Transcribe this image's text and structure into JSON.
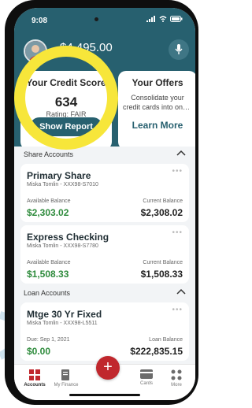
{
  "status": {
    "time": "9:08"
  },
  "header": {
    "total_balance": "$4,495.00"
  },
  "credit_card": {
    "title": "Your Credit Score",
    "score": "634",
    "rating": "Rating: FAIR",
    "button": "Show Report"
  },
  "offers_card": {
    "title": "Your Offers",
    "desc_line1": "Consolidate your",
    "desc_line2": "credit cards into one...",
    "link": "Learn More"
  },
  "sections": {
    "share_accounts": "Share Accounts",
    "loan_accounts": "Loan Accounts"
  },
  "accounts": [
    {
      "name": "Primary Share",
      "sub": "Miska Tomlin - XXX98-S7010",
      "left_label": "Available Balance",
      "left_value": "$2,303.02",
      "right_label": "Current Balance",
      "right_value": "$2,308.02"
    },
    {
      "name": "Express Checking",
      "sub": "Miska Tomlin - XXX98-S7780",
      "left_label": "Available Balance",
      "left_value": "$1,508.33",
      "right_label": "Current Balance",
      "right_value": "$1,508.33"
    }
  ],
  "loans": [
    {
      "name": "Mtge 30 Yr Fixed",
      "sub": "Miska Tomlin - XXX98-L5511",
      "left_label": "Due: Sep 1, 2021",
      "left_value": "$0.00",
      "right_label": "Loan Balance",
      "right_value": "$222,835.15"
    }
  ],
  "tabbar": {
    "accounts": "Accounts",
    "my_finance": "My Finance",
    "cards": "Cards",
    "more": "More"
  },
  "colors": {
    "brand": "#27606f",
    "accent_red": "#c0272d",
    "positive": "#2e8b3c",
    "highlight": "#f7e63a"
  }
}
